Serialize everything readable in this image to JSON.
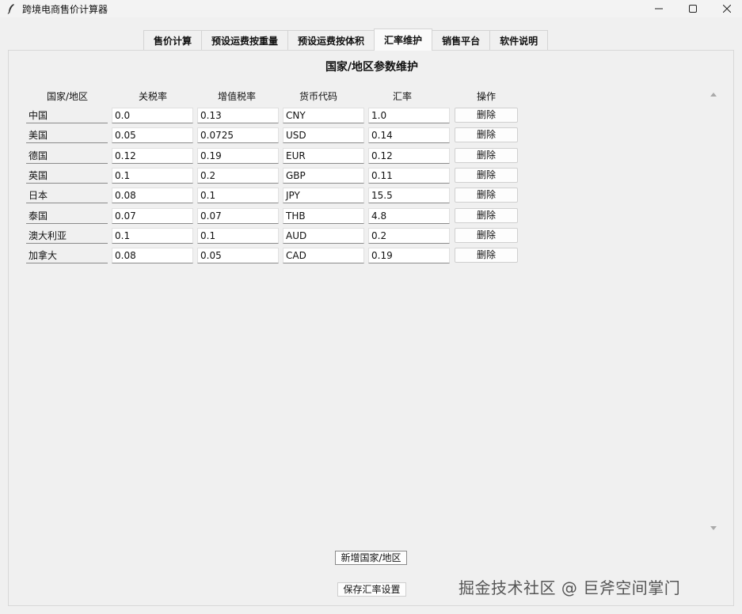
{
  "window": {
    "title": "跨境电商售价计算器",
    "minimize_glyph": "—",
    "maximize_glyph": "☐",
    "close_glyph": "✕"
  },
  "tabs": [
    {
      "label": "售价计算",
      "active": false
    },
    {
      "label": "预设运费按重量",
      "active": false
    },
    {
      "label": "预设运费按体积",
      "active": false
    },
    {
      "label": "汇率维护",
      "active": true
    },
    {
      "label": "销售平台",
      "active": false
    },
    {
      "label": "软件说明",
      "active": false
    }
  ],
  "panel": {
    "title": "国家/地区参数维护",
    "columns": [
      "国家/地区",
      "关税率",
      "增值税率",
      "货币代码",
      "汇率",
      "操作"
    ],
    "delete_label": "删除",
    "rows": [
      {
        "name": "中国",
        "tariff": "0.0",
        "vat": "0.13",
        "currency": "CNY",
        "rate": "1.0"
      },
      {
        "name": "美国",
        "tariff": "0.05",
        "vat": "0.0725",
        "currency": "USD",
        "rate": "0.14"
      },
      {
        "name": "德国",
        "tariff": "0.12",
        "vat": "0.19",
        "currency": "EUR",
        "rate": "0.12"
      },
      {
        "name": "英国",
        "tariff": "0.1",
        "vat": "0.2",
        "currency": "GBP",
        "rate": "0.11"
      },
      {
        "name": "日本",
        "tariff": "0.08",
        "vat": "0.1",
        "currency": "JPY",
        "rate": "15.5"
      },
      {
        "name": "泰国",
        "tariff": "0.07",
        "vat": "0.07",
        "currency": "THB",
        "rate": "4.8"
      },
      {
        "name": "澳大利亚",
        "tariff": "0.1",
        "vat": "0.1",
        "currency": "AUD",
        "rate": "0.2"
      },
      {
        "name": "加拿大",
        "tariff": "0.08",
        "vat": "0.05",
        "currency": "CAD",
        "rate": "0.19"
      }
    ],
    "add_button": "新增国家/地区",
    "save_button": "保存汇率设置"
  },
  "watermark": "掘金技术社区 @ 巨斧空间掌门"
}
